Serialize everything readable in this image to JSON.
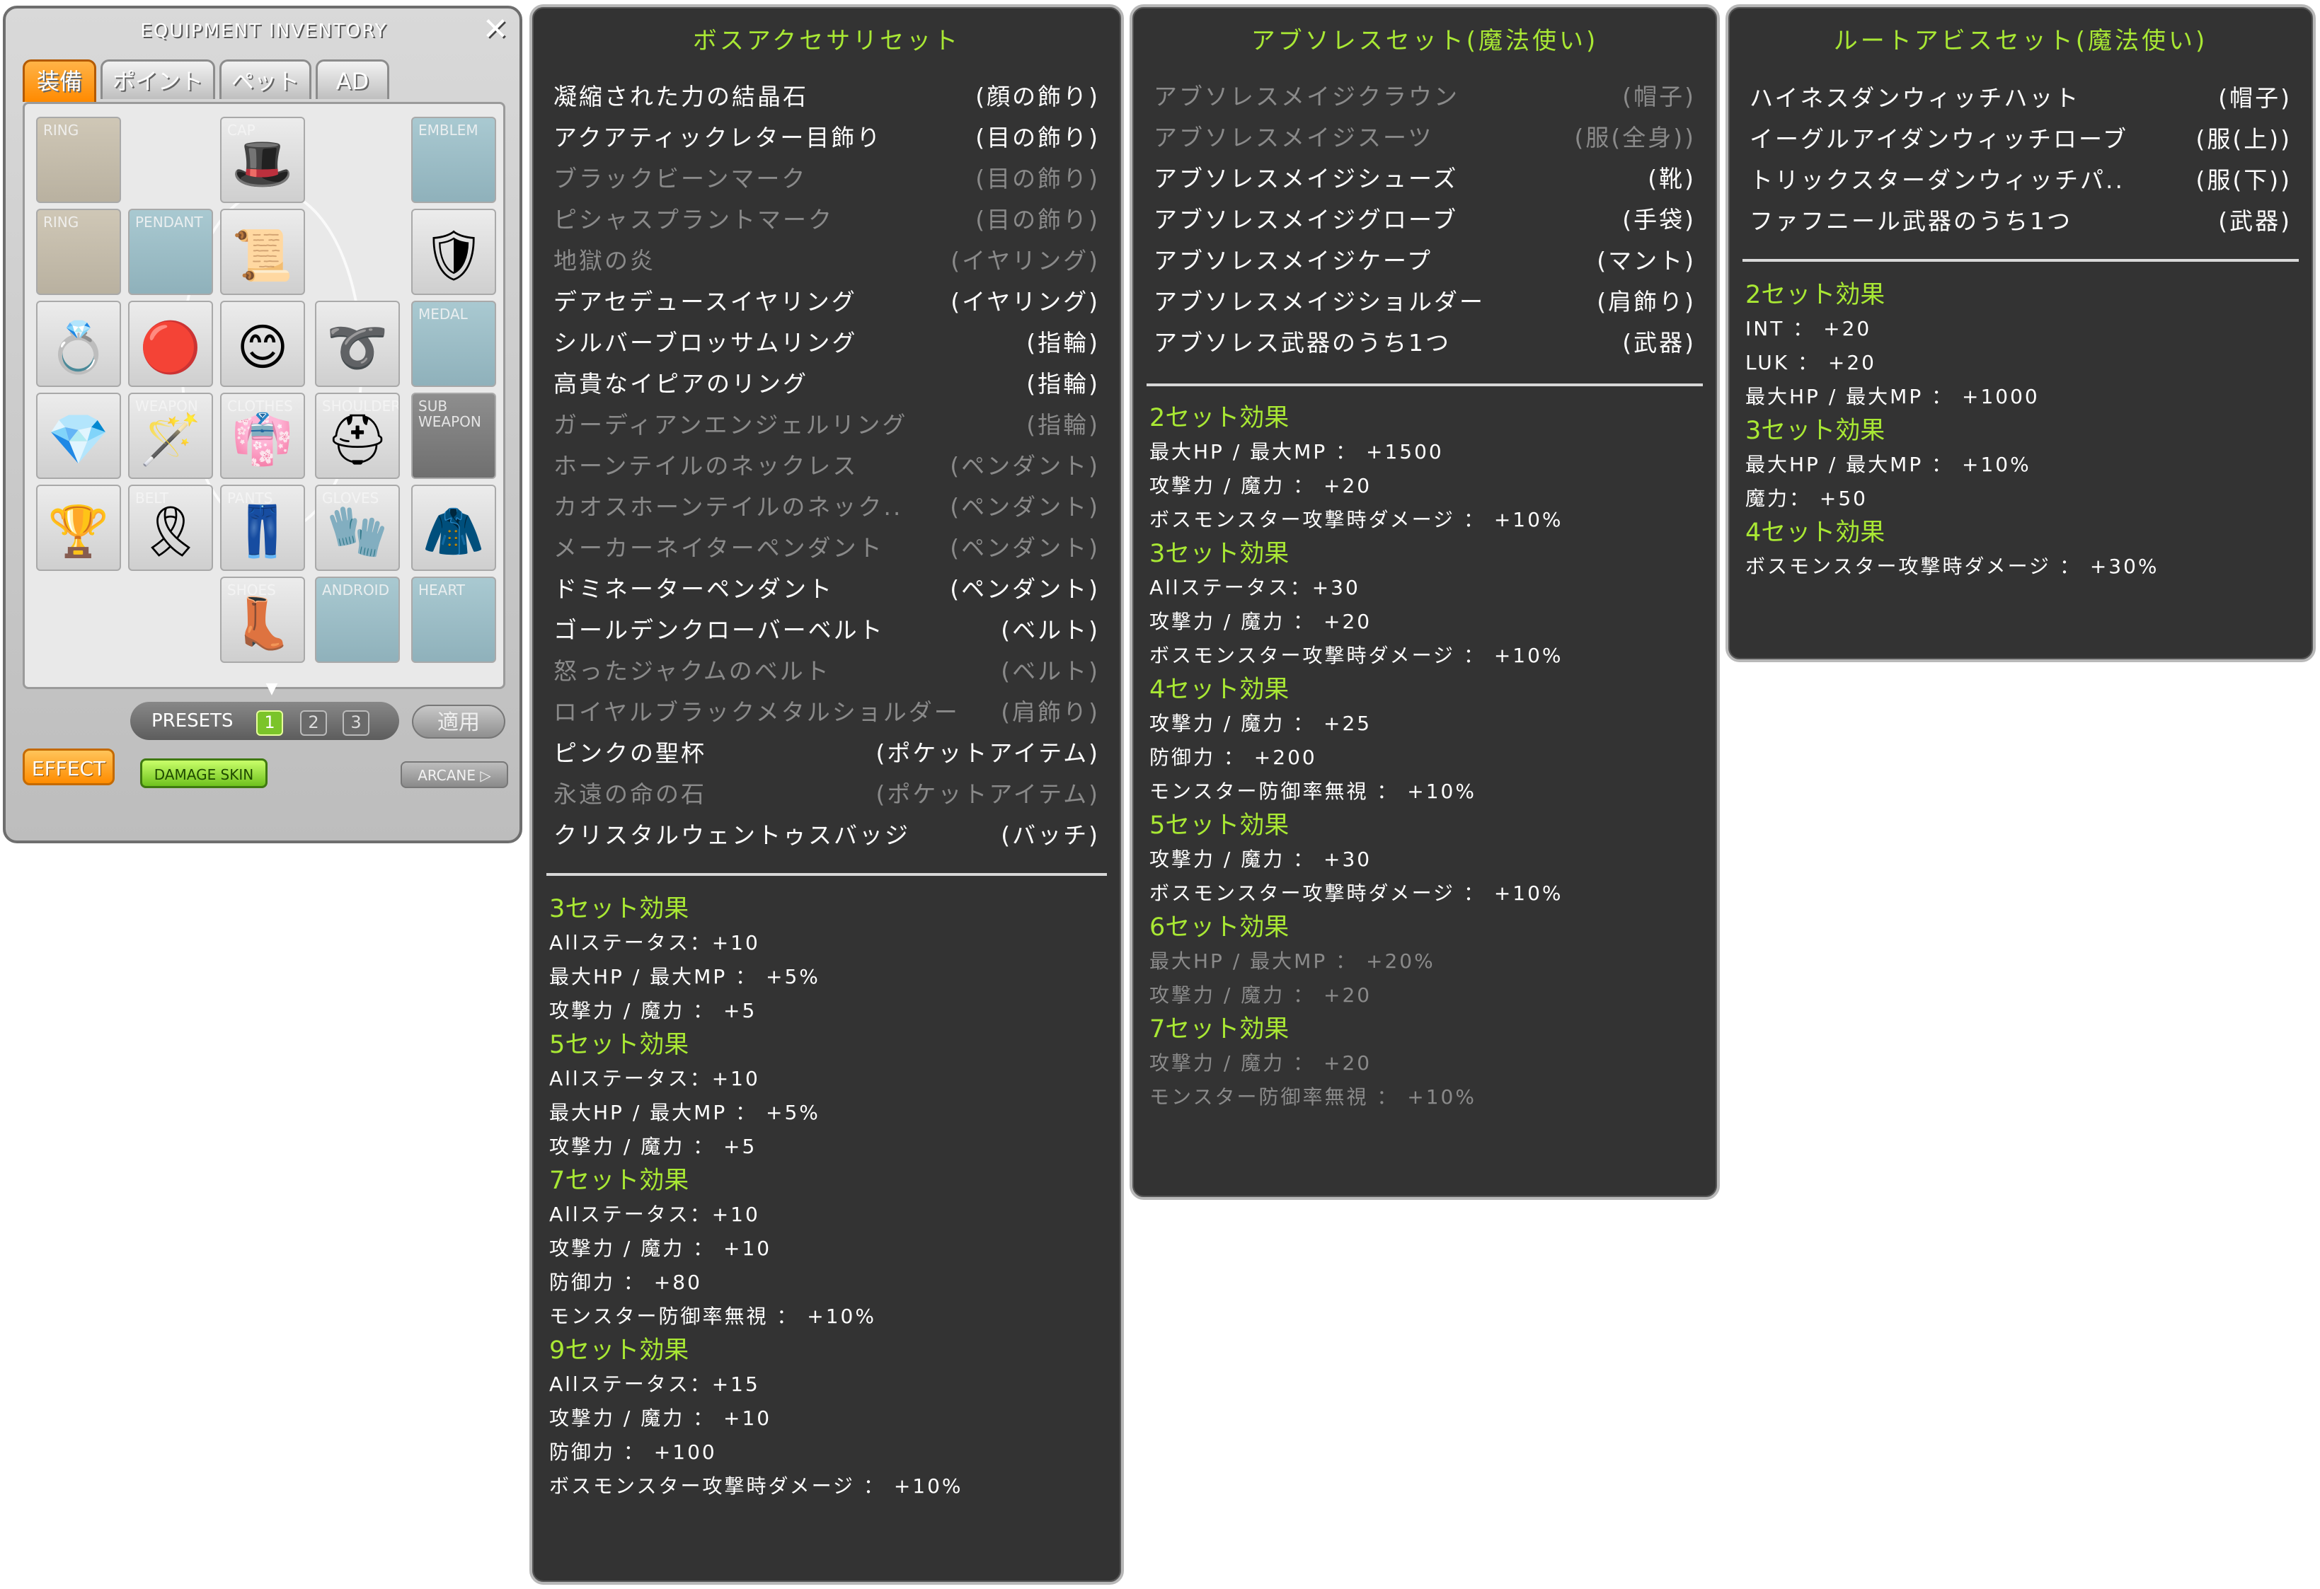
{
  "equip": {
    "title": "EQUIPMENT INVENTORY",
    "close": "✕",
    "tabs": [
      "装備",
      "ポイント",
      "ペット",
      "AD"
    ],
    "slots": {
      "ring1": "RING",
      "cap": "CAP",
      "emblem": "EMBLEM",
      "ring2": "RING",
      "pendant": "PENDANT",
      "medal": "MEDAL",
      "weapon": "WEAPON",
      "clothes": "CLOTHES",
      "shoulder": "SHOULDER",
      "subweapon": "SUB WEAPON",
      "belt": "BELT",
      "pants": "PANTS",
      "gloves": "GLOVES",
      "shoes": "SHOES",
      "android": "ANDROID",
      "heart": "HEART"
    },
    "presets_label": "PRESETS",
    "presets": [
      "1",
      "2",
      "3"
    ],
    "apply_label": "適用",
    "effect_label": "EFFECT",
    "damage_skin_label": "DAMAGE SKIN",
    "arcane_label": "ARCANE ▷"
  },
  "boss_set": {
    "title": "ボスアクセサリセット",
    "items": [
      {
        "name": "凝縮された力の結晶石",
        "slot": "(顔の飾り)",
        "active": true
      },
      {
        "name": "アクアティックレター目飾り",
        "slot": "(目の飾り)",
        "active": true
      },
      {
        "name": "ブラックビーンマーク",
        "slot": "(目の飾り)",
        "active": false
      },
      {
        "name": "ピシャスプラントマーク",
        "slot": "(目の飾り)",
        "active": false
      },
      {
        "name": "地獄の炎",
        "slot": "(イヤリング)",
        "active": false
      },
      {
        "name": "デアセデュースイヤリング",
        "slot": "(イヤリング)",
        "active": true
      },
      {
        "name": "シルバーブロッサムリング",
        "slot": "(指輪)",
        "active": true
      },
      {
        "name": "高貴なイピアのリング",
        "slot": "(指輪)",
        "active": true
      },
      {
        "name": "ガーディアンエンジェルリング",
        "slot": "(指輪)",
        "active": false
      },
      {
        "name": "ホーンテイルのネックレス",
        "slot": "(ペンダント)",
        "active": false
      },
      {
        "name": "カオスホーンテイルのネック..",
        "slot": "(ペンダント)",
        "active": false
      },
      {
        "name": "メーカーネイターペンダント",
        "slot": "(ペンダント)",
        "active": false
      },
      {
        "name": "ドミネーターペンダント",
        "slot": "(ペンダント)",
        "active": true
      },
      {
        "name": "ゴールデンクローバーベルト",
        "slot": "(ベルト)",
        "active": true
      },
      {
        "name": "怒ったジャクムのベルト",
        "slot": "(ベルト)",
        "active": false
      },
      {
        "name": "ロイヤルブラックメタルショルダー",
        "slot": "(肩飾り)",
        "active": false
      },
      {
        "name": "ピンクの聖杯",
        "slot": "(ポケットアイテム)",
        "active": true
      },
      {
        "name": "永遠の命の石",
        "slot": "(ポケットアイテム)",
        "active": false
      },
      {
        "name": "クリスタルウェントゥスバッジ",
        "slot": "(バッチ)",
        "active": true
      }
    ],
    "effects": [
      {
        "head": "3セット効果",
        "lines": [
          "Allステータス：+10",
          "最大HP / 最大MP ： +5%",
          "攻撃力 / 魔力 ： +5"
        ]
      },
      {
        "head": "5セット効果",
        "lines": [
          "Allステータス：+10",
          "最大HP / 最大MP ： +5%",
          "攻撃力 / 魔力 ： +5"
        ]
      },
      {
        "head": "7セット効果",
        "lines": [
          "Allステータス：+10",
          "攻撃力 / 魔力 ： +10",
          "防御力 ： +80",
          "モンスター防御率無視 ： +10%"
        ]
      },
      {
        "head": "9セット効果",
        "lines": [
          "Allステータス：+15",
          "攻撃力 / 魔力 ： +10",
          "防御力 ： +100",
          "ボスモンスター攻撃時ダメージ ： +10%"
        ]
      }
    ]
  },
  "absolab_set": {
    "title": "アブソレスセット(魔法使い)",
    "items": [
      {
        "name": "アブソレスメイジクラウン",
        "slot": "(帽子)",
        "active": false
      },
      {
        "name": "アブソレスメイジスーツ",
        "slot": "(服(全身))",
        "active": false
      },
      {
        "name": "アブソレスメイジシューズ",
        "slot": "(靴)",
        "active": true
      },
      {
        "name": "アブソレスメイジグローブ",
        "slot": "(手袋)",
        "active": true
      },
      {
        "name": "アブソレスメイジケープ",
        "slot": "(マント)",
        "active": true
      },
      {
        "name": "アブソレスメイジショルダー",
        "slot": "(肩飾り)",
        "active": true
      },
      {
        "name": "アブソレス武器のうち1つ",
        "slot": "(武器)",
        "active": true
      }
    ],
    "effects": [
      {
        "head": "2セット効果",
        "active": true,
        "lines": [
          "最大HP / 最大MP ： +1500",
          "攻撃力 / 魔力 ： +20",
          "ボスモンスター攻撃時ダメージ ： +10%"
        ]
      },
      {
        "head": "3セット効果",
        "active": true,
        "lines": [
          "Allステータス：+30",
          "攻撃力 / 魔力 ： +20",
          "ボスモンスター攻撃時ダメージ ： +10%"
        ]
      },
      {
        "head": "4セット効果",
        "active": true,
        "lines": [
          "攻撃力 / 魔力 ： +25",
          "防御力 ： +200",
          "モンスター防御率無視 ： +10%"
        ]
      },
      {
        "head": "5セット効果",
        "active": true,
        "lines": [
          "攻撃力 / 魔力 ： +30",
          "ボスモンスター攻撃時ダメージ ： +10%"
        ]
      },
      {
        "head": "6セット効果",
        "active": false,
        "lines": [
          "最大HP / 最大MP ： +20%",
          "攻撃力 / 魔力 ： +20"
        ]
      },
      {
        "head": "7セット効果",
        "active": false,
        "lines": [
          "攻撃力 / 魔力 ： +20",
          "モンスター防御率無視 ： +10%"
        ]
      }
    ]
  },
  "rootabyss_set": {
    "title": "ルートアビスセット(魔法使い)",
    "items": [
      {
        "name": "ハイネスダンウィッチハット",
        "slot": "(帽子)",
        "active": true
      },
      {
        "name": "イーグルアイダンウィッチローブ",
        "slot": "(服(上))",
        "active": true
      },
      {
        "name": "トリックスターダンウィッチパ..",
        "slot": "(服(下))",
        "active": true
      },
      {
        "name": "ファフニール武器のうち1つ",
        "slot": "(武器)",
        "active": true
      }
    ],
    "effects": [
      {
        "head": "2セット効果",
        "lines": [
          "INT ： +20",
          "LUK ： +20",
          "最大HP / 最大MP ： +1000"
        ]
      },
      {
        "head": "3セット効果",
        "lines": [
          "最大HP / 最大MP ： +10%",
          "魔力： +50"
        ]
      },
      {
        "head": "4セット効果",
        "lines": [
          "ボスモンスター攻撃時ダメージ ： +30%"
        ]
      }
    ]
  },
  "colors": {
    "effect_green": "#a9e834",
    "panel_bg": "#333333",
    "dim_text": "#8a8a8a"
  }
}
